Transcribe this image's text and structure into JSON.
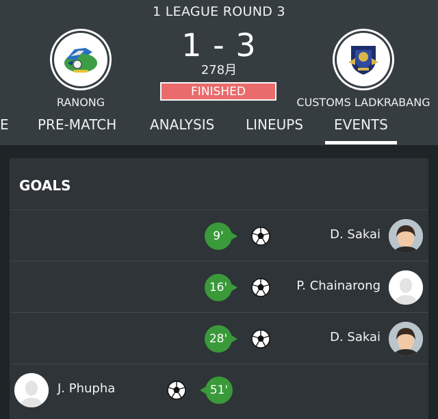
{
  "match": {
    "round_title": "1 LEAGUE ROUND 3",
    "score": "1 - 3",
    "date": "278月",
    "status": "FINISHED",
    "home_team": "RANONG",
    "away_team": "CUSTOMS LADKRABANG"
  },
  "tabs": [
    {
      "label": "E"
    },
    {
      "label": "PRE-MATCH"
    },
    {
      "label": "ANALYSIS"
    },
    {
      "label": "LINEUPS"
    },
    {
      "label": "EVENTS",
      "active": true
    }
  ],
  "events": {
    "section_title": "GOALS",
    "goals": [
      {
        "minute": "9'",
        "player": "D. Sakai",
        "side": "away",
        "avatar": "photo"
      },
      {
        "minute": "16'",
        "player": "P. Chainarong",
        "side": "away",
        "avatar": "placeholder"
      },
      {
        "minute": "28'",
        "player": "D. Sakai",
        "side": "away",
        "avatar": "photo"
      },
      {
        "minute": "51'",
        "player": "J. Phupha",
        "side": "home",
        "avatar": "placeholder"
      }
    ]
  },
  "colors": {
    "header_bg": "#363d41",
    "page_bg": "#1f2427",
    "card_bg": "#2e3438",
    "status_red": "#e96b6b",
    "goal_green": "#3a9a3a"
  },
  "icons": {
    "event": "soccer-ball-icon"
  }
}
